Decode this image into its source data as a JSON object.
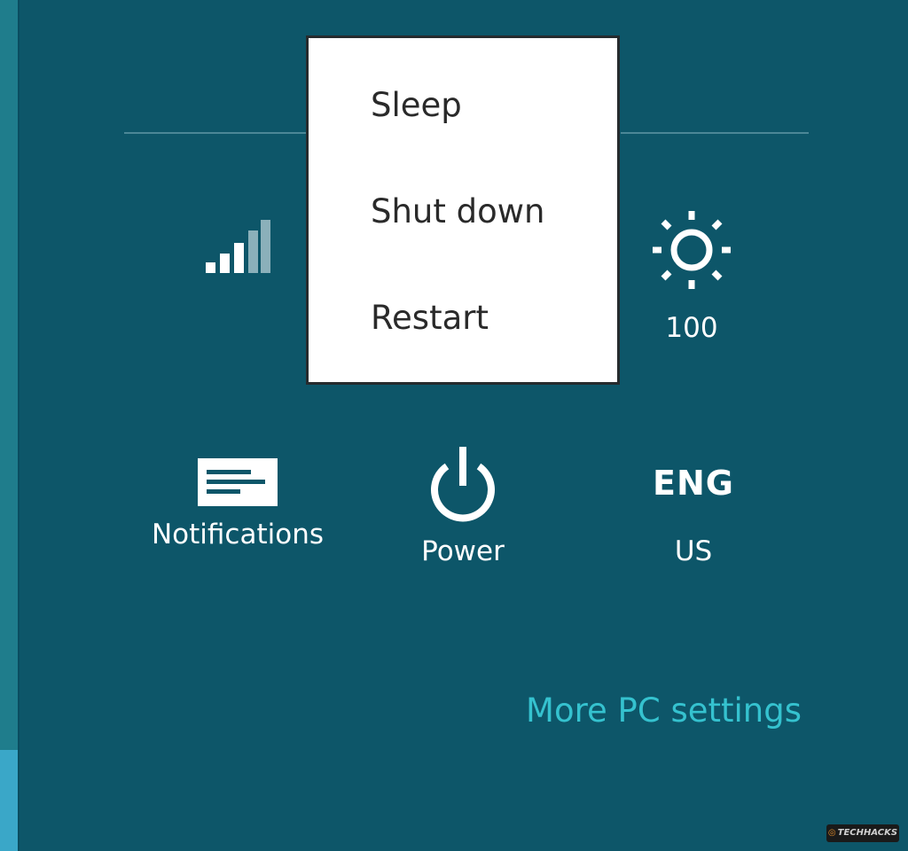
{
  "flyout": {
    "items": [
      "Sleep",
      "Shut down",
      "Restart"
    ]
  },
  "network": {
    "icon": "wifi-signal-icon"
  },
  "brightness": {
    "icon": "brightness-sun-icon",
    "value": "100"
  },
  "tiles": {
    "notifications": {
      "icon": "notifications-icon",
      "label": "Notifications"
    },
    "power": {
      "icon": "power-icon",
      "label": "Power"
    },
    "language": {
      "code": "ENG",
      "region": "US"
    }
  },
  "links": {
    "more_pc_settings": "More PC settings"
  },
  "watermark": {
    "text": "TECHHACKS"
  },
  "colors": {
    "background": "#0d5669",
    "accent_link": "#35c2cf",
    "flyout_bg": "#ffffff",
    "flyout_text": "#2a2a2a"
  }
}
